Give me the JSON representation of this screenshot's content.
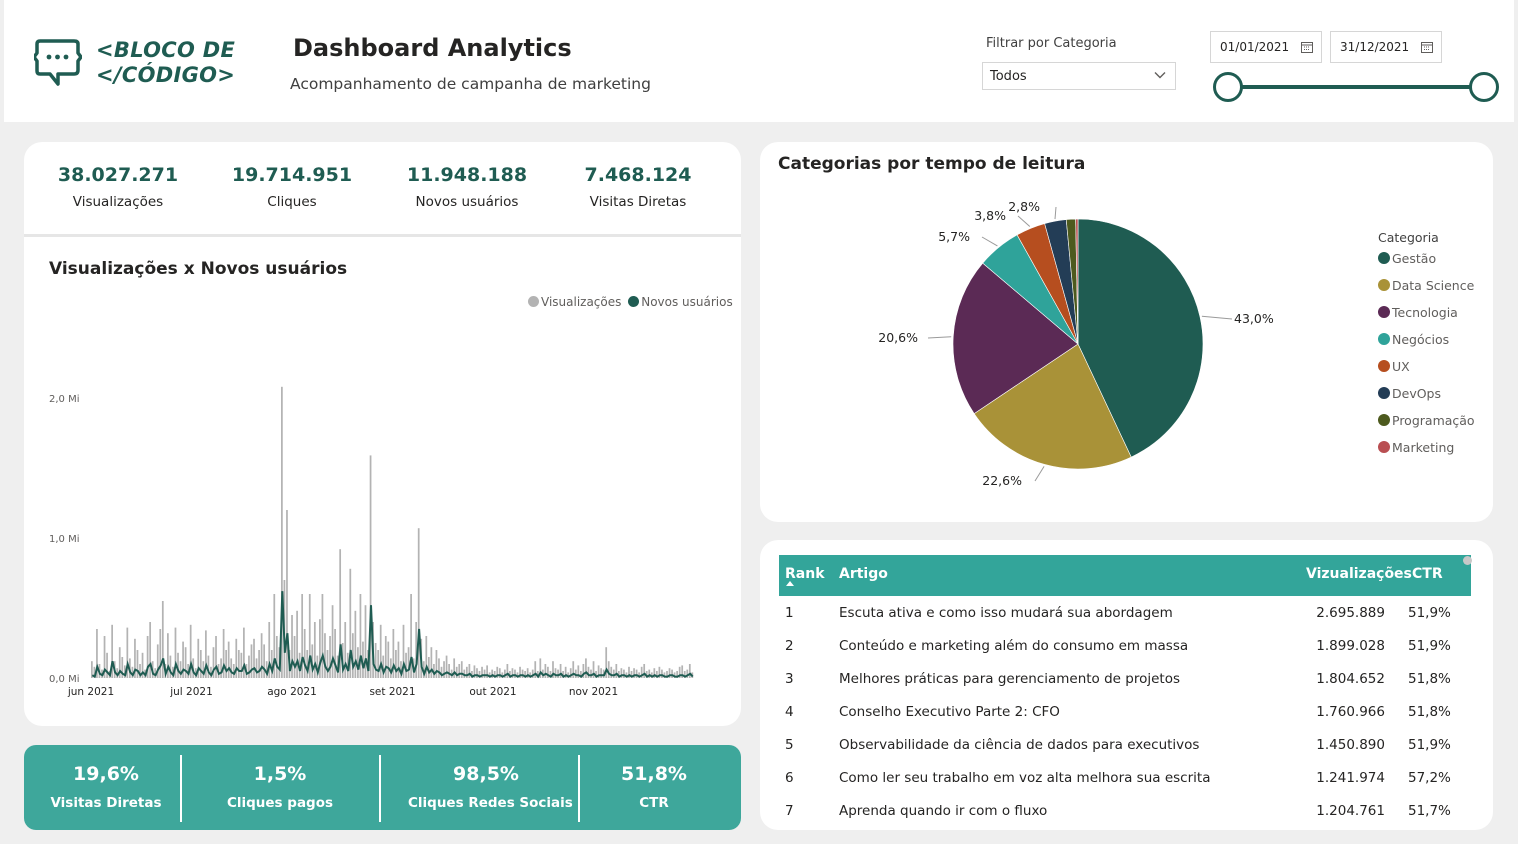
{
  "brand": {
    "line1": "<BLOCO DE",
    "line2": "</CÓDIGO>"
  },
  "header": {
    "title": "Dashboard Analytics",
    "subtitle": "Acompanhamento de campanha de marketing"
  },
  "filter": {
    "label": "Filtrar por Categoria",
    "value": "Todos"
  },
  "date_range": {
    "start": "01/01/2021",
    "end": "31/12/2021",
    "slider_start": 0.0,
    "slider_end": 1.0
  },
  "kpis": [
    {
      "value": "38.027.271",
      "label": "Visualizações"
    },
    {
      "value": "19.714.951",
      "label": "Cliques"
    },
    {
      "value": "11.948.188",
      "label": "Novos usuários"
    },
    {
      "value": "7.468.124",
      "label": "Visitas Diretas"
    }
  ],
  "bottom_kpis": [
    {
      "value": "19,6%",
      "label": "Visitas Diretas"
    },
    {
      "value": "1,5%",
      "label": "Cliques pagos"
    },
    {
      "value": "98,5%",
      "label": "Cliques Redes Sociais"
    },
    {
      "value": "51,8%",
      "label": "CTR"
    }
  ],
  "colors": {
    "brand": "#1f5c52",
    "accent": "#3ea79b",
    "bars": "#b3b3b3",
    "line": "#1f5c52"
  },
  "chart_data": [
    {
      "type": "bar",
      "title": "Visualizações x Novos usuários",
      "x_ticks": [
        "jun 2021",
        "jul 2021",
        "ago 2021",
        "set 2021",
        "out 2021",
        "nov 2021"
      ],
      "y_ticks": [
        "0,0 Mi",
        "1,0 Mi",
        "2,0 Mi"
      ],
      "ylim": [
        0,
        2.0
      ],
      "y_unit": "Mi",
      "legend_position": "top-right",
      "series": [
        {
          "name": "Visualizações",
          "type": "bar",
          "color": "#b3b3b3",
          "values": [
            0.12,
            0.08,
            0.35,
            0.1,
            0.06,
            0.3,
            0.18,
            0.05,
            0.38,
            0.12,
            0.07,
            0.22,
            0.15,
            0.09,
            0.36,
            0.14,
            0.08,
            0.28,
            0.2,
            0.1,
            0.18,
            0.06,
            0.3,
            0.4,
            0.12,
            0.07,
            0.24,
            0.35,
            0.55,
            0.1,
            0.32,
            0.16,
            0.08,
            0.36,
            0.18,
            0.12,
            0.26,
            0.22,
            0.1,
            0.38,
            0.14,
            0.07,
            0.28,
            0.2,
            0.12,
            0.34,
            0.16,
            0.08,
            0.22,
            0.3,
            0.1,
            0.14,
            0.35,
            0.2,
            0.26,
            0.14,
            0.1,
            0.28,
            0.2,
            0.18,
            0.36,
            0.1,
            0.16,
            0.24,
            0.28,
            0.14,
            0.2,
            0.32,
            0.24,
            0.12,
            0.4,
            0.2,
            0.6,
            0.3,
            0.22,
            2.08,
            0.7,
            1.2,
            0.2,
            0.45,
            0.3,
            0.48,
            0.18,
            0.6,
            0.35,
            0.2,
            0.6,
            0.24,
            0.4,
            0.16,
            0.42,
            0.6,
            0.32,
            0.2,
            0.3,
            0.52,
            0.35,
            0.16,
            0.92,
            0.25,
            0.4,
            0.18,
            0.78,
            0.32,
            0.48,
            0.22,
            0.6,
            0.26,
            0.52,
            0.2,
            1.59,
            0.4,
            0.25,
            0.2,
            0.38,
            0.16,
            0.3,
            0.26,
            0.14,
            0.35,
            0.2,
            0.26,
            0.12,
            0.38,
            0.18,
            0.22,
            0.6,
            0.14,
            0.4,
            1.07,
            0.28,
            0.12,
            0.3,
            0.15,
            0.22,
            0.1,
            0.2,
            0.14,
            0.08,
            0.12,
            0.16,
            0.1,
            0.06,
            0.14,
            0.08,
            0.1,
            0.12,
            0.06,
            0.08,
            0.1,
            0.05,
            0.09,
            0.07,
            0.05,
            0.08,
            0.06,
            0.09,
            0.04,
            0.06,
            0.05,
            0.08,
            0.07,
            0.04,
            0.06,
            0.1,
            0.05,
            0.07,
            0.06,
            0.04,
            0.08,
            0.06,
            0.05,
            0.07,
            0.04,
            0.06,
            0.12,
            0.05,
            0.14,
            0.06,
            0.1,
            0.08,
            0.05,
            0.12,
            0.07,
            0.06,
            0.1,
            0.05,
            0.08,
            0.04,
            0.07,
            0.12,
            0.06,
            0.09,
            0.05,
            0.1,
            0.14,
            0.08,
            0.06,
            0.12,
            0.05,
            0.09,
            0.07,
            0.06,
            0.22,
            0.12,
            0.08,
            0.06,
            0.1,
            0.05,
            0.07,
            0.06,
            0.04,
            0.08,
            0.05,
            0.07,
            0.06,
            0.04,
            0.08,
            0.1,
            0.05,
            0.06,
            0.04,
            0.07,
            0.05,
            0.08,
            0.06,
            0.04,
            0.05,
            0.07,
            0.06,
            0.04,
            0.05,
            0.08,
            0.09,
            0.05,
            0.06,
            0.1,
            0.04
          ]
        },
        {
          "name": "Novos usuários",
          "type": "line",
          "color": "#1f5c52",
          "values": [
            0.02,
            0.01,
            0.08,
            0.03,
            0.02,
            0.06,
            0.04,
            0.02,
            0.12,
            0.04,
            0.02,
            0.05,
            0.03,
            0.02,
            0.1,
            0.04,
            0.02,
            0.06,
            0.05,
            0.02,
            0.04,
            0.02,
            0.08,
            0.1,
            0.03,
            0.02,
            0.06,
            0.09,
            0.14,
            0.03,
            0.08,
            0.04,
            0.02,
            0.1,
            0.05,
            0.03,
            0.06,
            0.05,
            0.03,
            0.1,
            0.04,
            0.02,
            0.07,
            0.05,
            0.03,
            0.09,
            0.04,
            0.02,
            0.06,
            0.08,
            0.03,
            0.04,
            0.09,
            0.05,
            0.07,
            0.04,
            0.03,
            0.07,
            0.05,
            0.05,
            0.09,
            0.03,
            0.04,
            0.06,
            0.07,
            0.04,
            0.05,
            0.08,
            0.06,
            0.03,
            0.1,
            0.05,
            0.14,
            0.08,
            0.06,
            0.62,
            0.18,
            0.32,
            0.05,
            0.12,
            0.08,
            0.12,
            0.05,
            0.15,
            0.09,
            0.05,
            0.16,
            0.06,
            0.1,
            0.04,
            0.11,
            0.16,
            0.08,
            0.05,
            0.08,
            0.14,
            0.09,
            0.04,
            0.24,
            0.06,
            0.1,
            0.05,
            0.2,
            0.08,
            0.12,
            0.06,
            0.16,
            0.07,
            0.14,
            0.05,
            0.52,
            0.1,
            0.06,
            0.05,
            0.1,
            0.04,
            0.08,
            0.07,
            0.04,
            0.09,
            0.05,
            0.07,
            0.03,
            0.1,
            0.05,
            0.06,
            0.15,
            0.04,
            0.1,
            0.35,
            0.08,
            0.03,
            0.08,
            0.04,
            0.06,
            0.03,
            0.05,
            0.04,
            0.02,
            0.03,
            0.04,
            0.03,
            0.02,
            0.04,
            0.02,
            0.03,
            0.03,
            0.02,
            0.02,
            0.03,
            0.01,
            0.02,
            0.02,
            0.01,
            0.02,
            0.02,
            0.02,
            0.01,
            0.02,
            0.01,
            0.02,
            0.02,
            0.01,
            0.02,
            0.03,
            0.01,
            0.02,
            0.02,
            0.01,
            0.02,
            0.02,
            0.01,
            0.02,
            0.01,
            0.02,
            0.03,
            0.01,
            0.04,
            0.02,
            0.03,
            0.02,
            0.01,
            0.03,
            0.02,
            0.02,
            0.03,
            0.01,
            0.02,
            0.01,
            0.02,
            0.03,
            0.02,
            0.02,
            0.01,
            0.03,
            0.04,
            0.02,
            0.02,
            0.03,
            0.01,
            0.02,
            0.02,
            0.02,
            0.06,
            0.03,
            0.02,
            0.02,
            0.03,
            0.01,
            0.02,
            0.02,
            0.01,
            0.02,
            0.01,
            0.02,
            0.02,
            0.01,
            0.02,
            0.03,
            0.01,
            0.02,
            0.01,
            0.02,
            0.01,
            0.02,
            0.02,
            0.01,
            0.01,
            0.02,
            0.02,
            0.01,
            0.01,
            0.02,
            0.02,
            0.01,
            0.02,
            0.03,
            0.01
          ]
        }
      ]
    },
    {
      "type": "pie",
      "title": "Categorias por tempo de leitura",
      "legend_title": "Categoria",
      "legend_position": "right",
      "slices": [
        {
          "name": "Gestão",
          "value": 43.0,
          "label": "43,0%",
          "color": "#1f5c52"
        },
        {
          "name": "Data Science",
          "value": 22.6,
          "label": "22,6%",
          "color": "#a99238"
        },
        {
          "name": "Tecnologia",
          "value": 20.6,
          "label": "20,6%",
          "color": "#5b2a55"
        },
        {
          "name": "Negócios",
          "value": 5.7,
          "label": "5,7%",
          "color": "#2fa39a"
        },
        {
          "name": "UX",
          "value": 3.8,
          "label": "3,8%",
          "color": "#b64e1f"
        },
        {
          "name": "DevOps",
          "value": 2.8,
          "label": "2,8%",
          "color": "#233d56"
        },
        {
          "name": "Programação",
          "value": 1.2,
          "label": "",
          "color": "#4d5a1e"
        },
        {
          "name": "Marketing",
          "value": 0.3,
          "label": "",
          "color": "#b94f52"
        }
      ]
    }
  ],
  "table": {
    "headers": {
      "rank": "Rank",
      "artigo": "Artigo",
      "views": "Vizualizações",
      "ctr": "CTR"
    },
    "rows": [
      {
        "rank": "1",
        "artigo": "Escuta ativa e como isso mudará sua abordagem",
        "views": "2.695.889",
        "ctr": "51,9%"
      },
      {
        "rank": "2",
        "artigo": "Conteúdo e marketing além do consumo em massa",
        "views": "1.899.028",
        "ctr": "51,9%"
      },
      {
        "rank": "3",
        "artigo": "Melhores práticas para gerenciamento de projetos",
        "views": "1.804.652",
        "ctr": "51,8%"
      },
      {
        "rank": "4",
        "artigo": "Conselho Executivo Parte 2: CFO",
        "views": "1.760.966",
        "ctr": "51,8%"
      },
      {
        "rank": "5",
        "artigo": "Observabilidade da ciência de dados para executivos",
        "views": "1.450.890",
        "ctr": "51,9%"
      },
      {
        "rank": "6",
        "artigo": "Como ler seu trabalho em voz alta melhora sua escrita",
        "views": "1.241.974",
        "ctr": "57,2%"
      },
      {
        "rank": "7",
        "artigo": "Aprenda quando ir com o fluxo",
        "views": "1.204.761",
        "ctr": "51,7%"
      }
    ]
  }
}
